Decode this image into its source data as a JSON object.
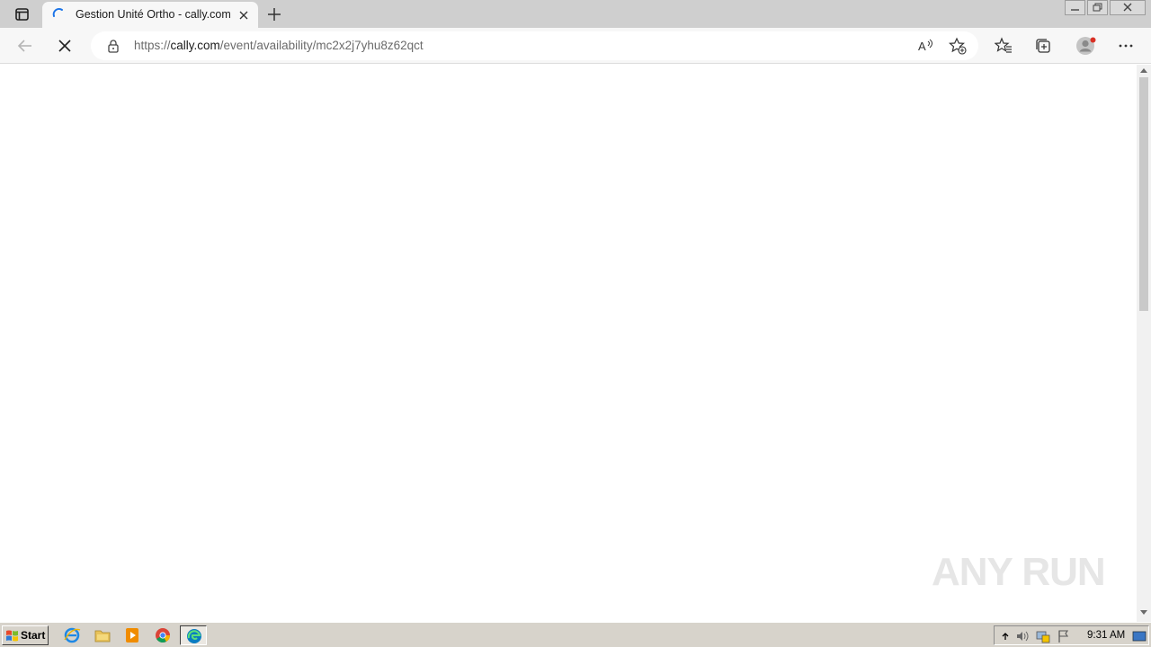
{
  "browser": {
    "tab": {
      "title": "Gestion Unité Ortho - cally.com",
      "loading": true
    },
    "address_bar": {
      "scheme": "https://",
      "host": "cally.com",
      "path": "/event/availability/mc2x2j7yhu8z62qct"
    },
    "icons": {
      "tab_actions": "tab-actions-icon",
      "close_tab": "close-icon",
      "new_tab": "plus-icon",
      "back": "back-arrow-icon",
      "stop": "stop-icon",
      "lock": "lock-icon",
      "read_aloud": "read-aloud-icon",
      "add_favorite": "add-favorite-icon",
      "favorites": "favorites-icon",
      "collections": "collections-icon",
      "profile": "profile-avatar",
      "more": "more-icon"
    },
    "accent": "#1a73e8"
  },
  "page": {
    "content": "",
    "watermark": "ANY RUN"
  },
  "taskbar": {
    "start_label": "Start",
    "pinned": [
      "internet-explorer-icon",
      "folder-icon",
      "media-player-icon",
      "chrome-icon",
      "edge-icon"
    ],
    "active_app": "edge-icon",
    "clock": "9:31 AM"
  }
}
